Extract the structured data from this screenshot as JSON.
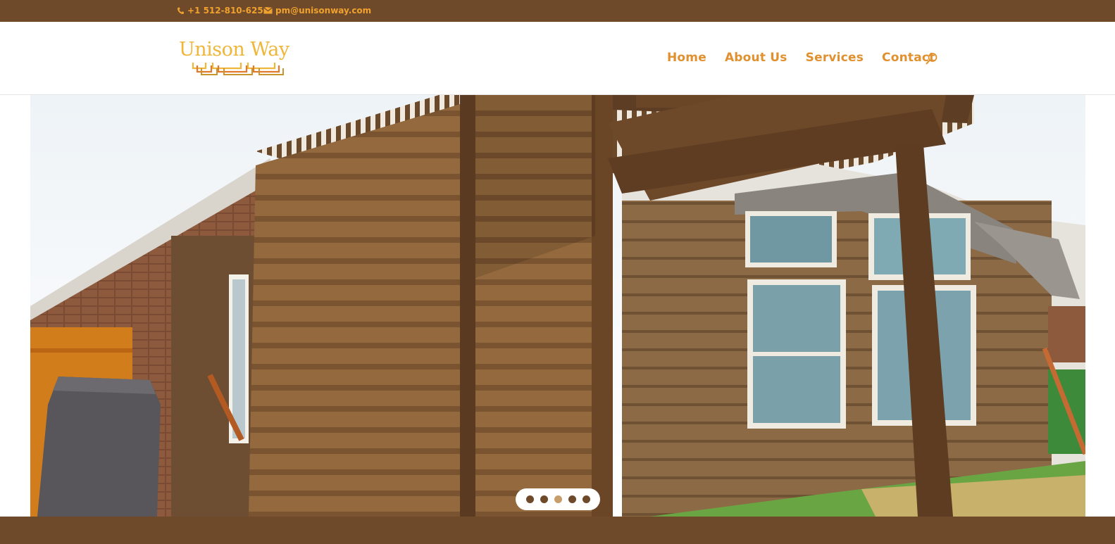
{
  "topbar": {
    "phone": "+1 512-810-6256",
    "email": "pm@unisonway.com",
    "phone_icon": "phone-icon",
    "email_icon": "envelope-icon"
  },
  "brand": {
    "name": "Unison Way",
    "logo_color": "#f0b63a"
  },
  "nav": {
    "items": [
      {
        "label": "Home"
      },
      {
        "label": "About Us"
      },
      {
        "label": "Services"
      },
      {
        "label": "Contact"
      }
    ],
    "search_icon": "search-icon",
    "color": "#e0902e"
  },
  "hero": {
    "image_subject": "wooden slat privacy screen and pergola beside a brown house",
    "slides_total": 5,
    "active_slide": 3
  },
  "colors": {
    "brand_brown": "#6e4a2b",
    "accent_orange": "#f0a12e"
  }
}
